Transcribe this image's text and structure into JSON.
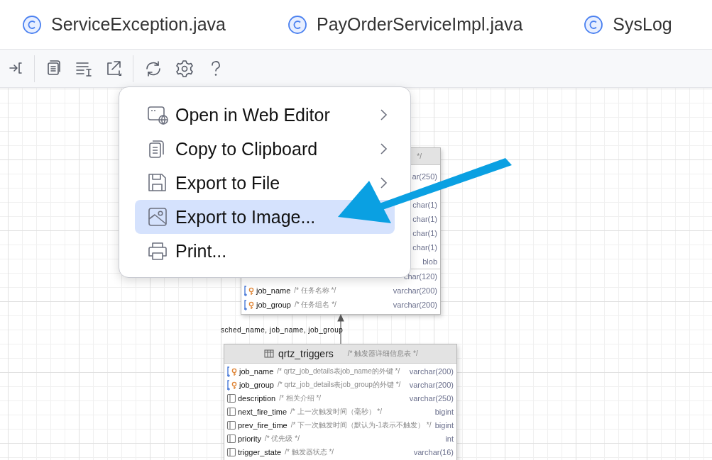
{
  "tabs": [
    {
      "label": "ServiceException.java",
      "selected": false
    },
    {
      "label": "PayOrderServiceImpl.java",
      "selected": false
    },
    {
      "label": "SysLog",
      "selected": false
    }
  ],
  "diagram": {
    "tables": [
      {
        "header_comment": "*/",
        "rows": [
          {
            "kind": "hidden",
            "type": "ar(250)"
          },
          {
            "kind": "hidden"
          },
          {
            "kind": "hidden",
            "type": "char(1)"
          },
          {
            "kind": "hidden",
            "type": "char(1)"
          },
          {
            "kind": "hidden",
            "type": "char(1)"
          },
          {
            "kind": "hidden",
            "type": "char(1)"
          },
          {
            "kind": "hidden",
            "type": "blob"
          },
          {
            "kind": "hidden",
            "type": "char(120)",
            "separator": true
          },
          {
            "kind": "foreign_key",
            "name": "job_name",
            "comment": "/* 任务名称 */",
            "type": "varchar(200)"
          },
          {
            "kind": "foreign_key",
            "name": "job_group",
            "comment": "/* 任务组名 */",
            "type": "varchar(200)"
          }
        ]
      },
      {
        "title": "qrtz_triggers",
        "header_comment": "/* 触发器详细信息表 */",
        "rows": [
          {
            "kind": "foreign_key",
            "name": "job_name",
            "comment": "/* qrtz_job_details表job_name的外键 */",
            "type": "varchar(200)"
          },
          {
            "kind": "foreign_key",
            "name": "job_group",
            "comment": "/* qrtz_job_details表job_group的外键 */",
            "type": "varchar(200)"
          },
          {
            "kind": "column",
            "name": "description",
            "comment": "/* 相关介绍 */",
            "type": "varchar(250)"
          },
          {
            "kind": "column",
            "name": "next_fire_time",
            "comment": "/* 上一次触发时间（毫秒） */",
            "type": "bigint"
          },
          {
            "kind": "column",
            "name": "prev_fire_time",
            "comment": "/* 下一次触发时间（默认为-1表示不触发） */",
            "type": "bigint"
          },
          {
            "kind": "column",
            "name": "priority",
            "comment": "/* 优先级 */",
            "type": "int"
          },
          {
            "kind": "column",
            "name": "trigger_state",
            "comment": "/* 触发器状态 */",
            "type": "varchar(16)"
          }
        ]
      }
    ],
    "relation_label": "sched_name, job_name, job_group"
  },
  "menu": {
    "items": [
      {
        "label": "Open in Web Editor",
        "submenu": true,
        "selected": false
      },
      {
        "label": "Copy to Clipboard",
        "submenu": true,
        "selected": false
      },
      {
        "label": "Export to File",
        "submenu": true,
        "selected": false
      },
      {
        "label": "Export to Image...",
        "submenu": false,
        "selected": true
      },
      {
        "label": "Print...",
        "submenu": false,
        "selected": false
      }
    ]
  }
}
